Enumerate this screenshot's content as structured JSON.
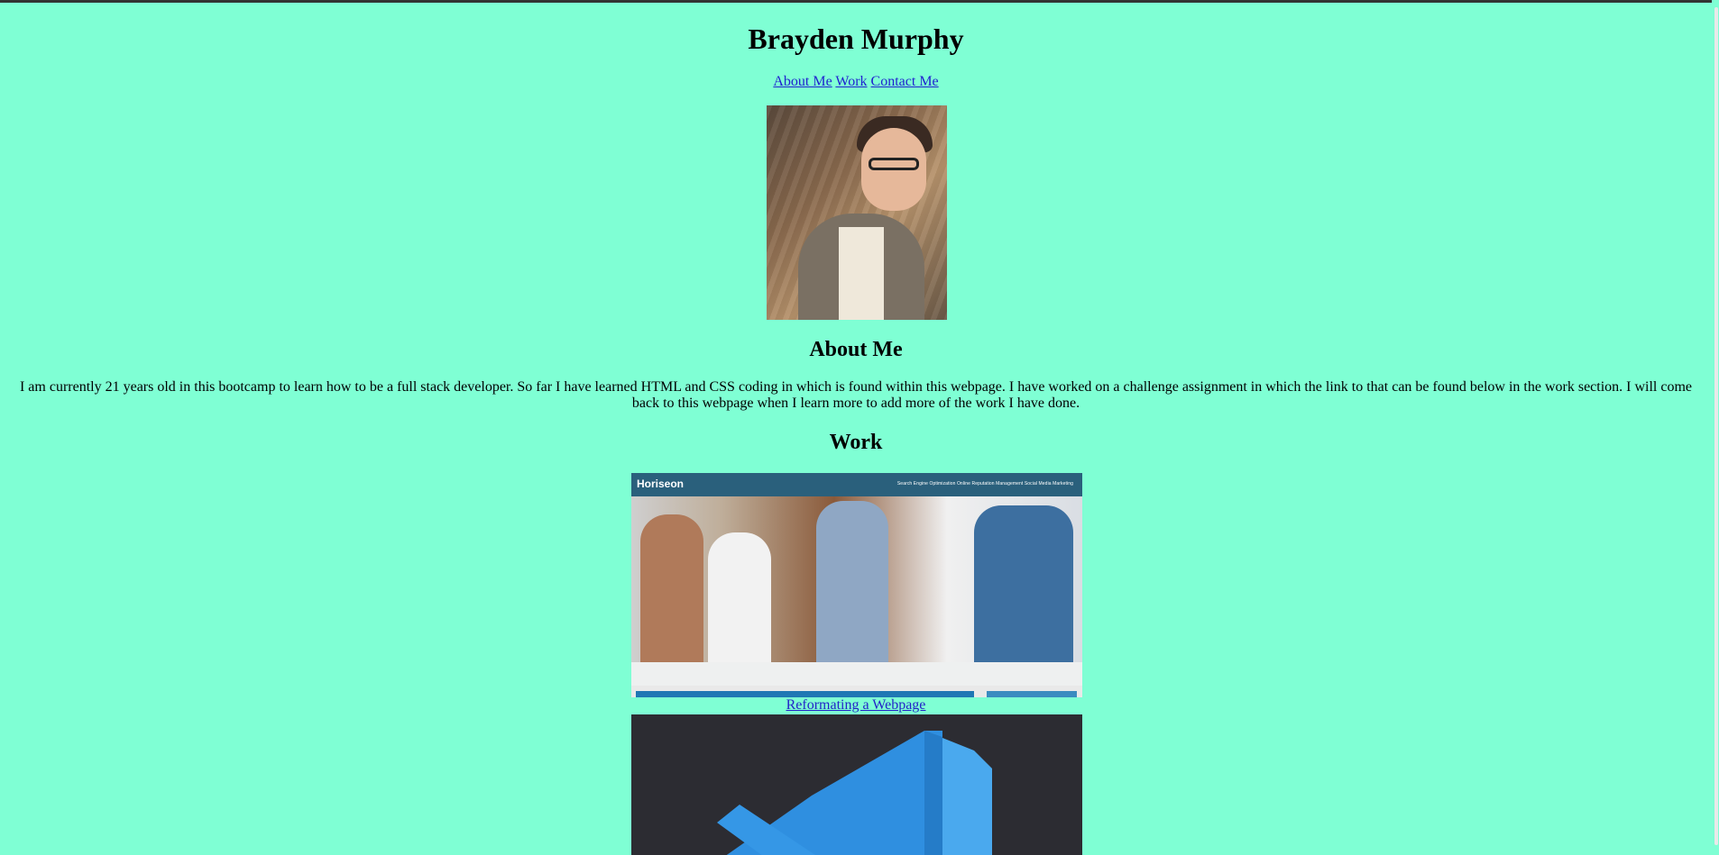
{
  "header": {
    "title": "Brayden Murphy"
  },
  "nav": {
    "items": [
      {
        "label": "About Me"
      },
      {
        "label": "Work"
      },
      {
        "label": "Contact Me"
      }
    ]
  },
  "about": {
    "title": "About Me",
    "text": "I am currently 21 years old in this bootcamp to learn how to be a full stack developer. So far I have learned HTML and CSS coding in which is found within this webpage. I have worked on a challenge assignment in which the link to that can be found below in the work section. I will come back to this webpage when I learn more to add more of the work I have done."
  },
  "work": {
    "title": "Work",
    "projects": [
      {
        "brand": "Horiseon",
        "menu": "Search Engine Optimization    Online Reputation Management    Social Media Marketing",
        "link_label": "Reformating a Webpage"
      }
    ]
  },
  "colors": {
    "background": "#7fffd4",
    "link": "#2323c8",
    "horiseon_header": "#2a607c",
    "vscode_blue": "#2f8fe0"
  }
}
